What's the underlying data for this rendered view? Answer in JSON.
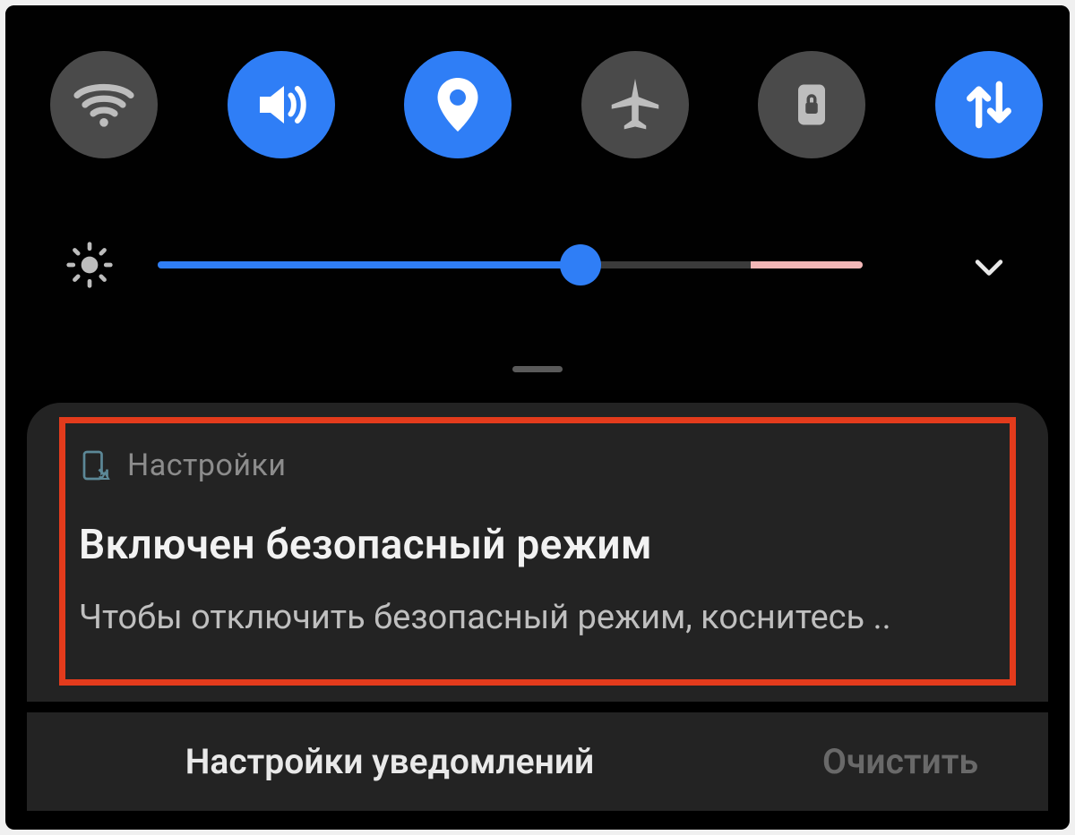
{
  "quick_settings": {
    "toggles": [
      {
        "name": "wifi",
        "active": false
      },
      {
        "name": "sound",
        "active": true
      },
      {
        "name": "location",
        "active": true
      },
      {
        "name": "airplane",
        "active": false
      },
      {
        "name": "rotation_lock",
        "active": false
      },
      {
        "name": "mobile_data",
        "active": true
      }
    ],
    "brightness": {
      "value": 60,
      "auto_boundary": 84
    }
  },
  "notification": {
    "app_name": "Настройки",
    "title": "Включен безопасный режим",
    "body": "Чтобы отключить безопасный режим, коснитесь .."
  },
  "footer": {
    "notification_settings_label": "Настройки уведомлений",
    "clear_label": "Очистить"
  },
  "colors": {
    "accent": "#2f7ef6",
    "toggle_off": "#4a4a4a",
    "highlight": "#e33b1c"
  }
}
